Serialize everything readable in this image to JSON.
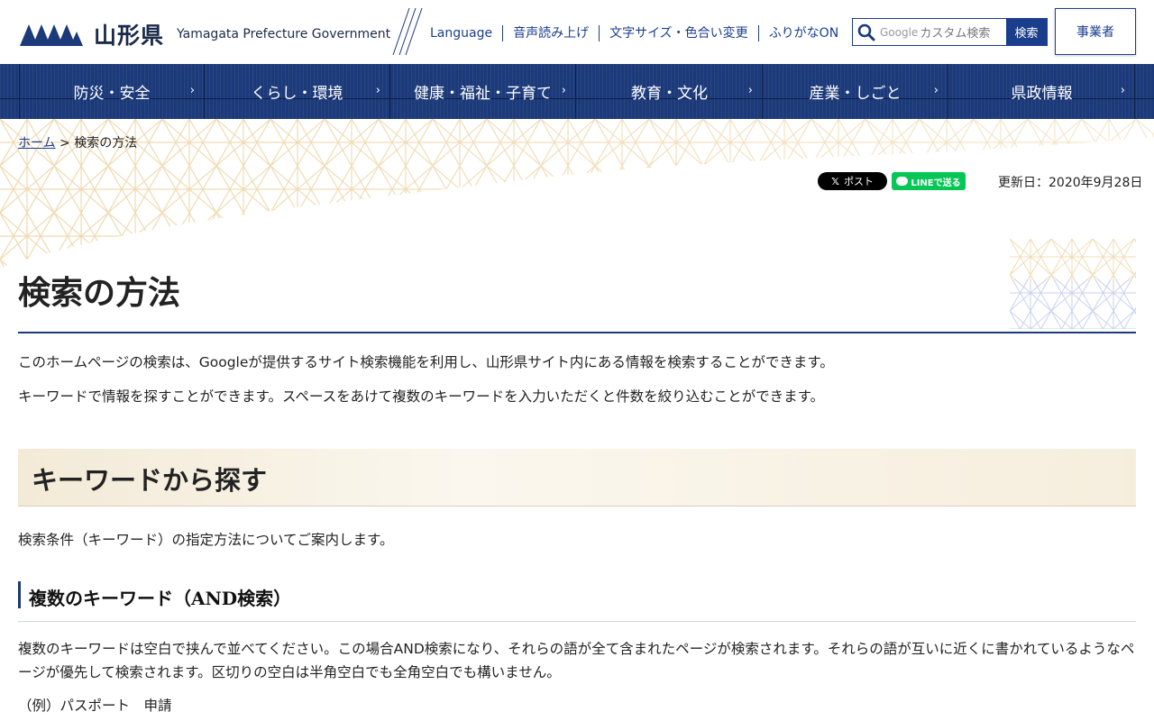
{
  "header": {
    "logo_jp": "山形県",
    "logo_en": "Yamagata Prefecture Government",
    "utility_links": [
      "Language",
      "音声読み上げ",
      "文字サイズ・色合い変更",
      "ふりがなON"
    ],
    "search": {
      "placeholder": "カスタム検索",
      "google_label": "Google",
      "button_label": "検索"
    },
    "business_button": "事業者"
  },
  "global_nav": [
    "防災・安全",
    "くらし・環境",
    "健康・福祉・子育て",
    "教育・文化",
    "産業・しごと",
    "県政情報"
  ],
  "breadcrumb": {
    "home": "ホーム",
    "separator": ">",
    "current": "検索の方法"
  },
  "share": {
    "x_label": "ポスト",
    "line_label": "LINEで送る"
  },
  "updated": "更新日：2020年9月28日",
  "content": {
    "title": "検索の方法",
    "intro_1": "このホームページの検索は、Googleが提供するサイト検索機能を利用し、山形県サイト内にある情報を検索することができます。",
    "intro_2": "キーワードで情報を探すことができます。スペースをあけて複数のキーワードを入力いただくと件数を絞り込むことができます。",
    "h2": "キーワードから探す",
    "h2_text": "検索条件（キーワード）の指定方法についてご案内します。",
    "h3": "複数のキーワード（AND検索）",
    "h3_text": "複数のキーワードは空白で挟んで並べてください。この場合AND検索になり、それらの語が全て含まれたページが検索されます。それらの語が互いに近くに書かれているようなページが優先して検索されます。区切りの空白は半角空白でも全角空白でも構いません。",
    "example": "（例）パスポート　申請"
  },
  "colors": {
    "brand_navy": "#1c3a7a",
    "link": "#1a3e8c",
    "line_green": "#06c755"
  }
}
